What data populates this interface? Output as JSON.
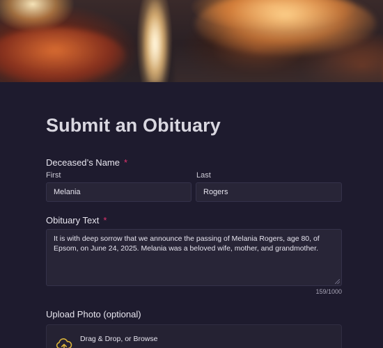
{
  "form": {
    "title": "Submit an Obituary",
    "required_marker": "*",
    "name": {
      "label": "Deceased’s Name",
      "first_label": "First",
      "first_value": "Melania",
      "last_label": "Last",
      "last_value": "Rogers"
    },
    "obituary": {
      "label": "Obituary Text",
      "value": "It is with deep sorrow that we announce the passing of Melania Rogers, age 80, of Epsom, on June 24, 2025. Melania was a beloved wife, mother, and grandmother.",
      "counter": "159/1000"
    },
    "upload": {
      "label": "Upload Photo (optional)",
      "title": "Drag & Drop, or Browse",
      "hint": "",
      "icon": "cloud-upload-icon",
      "accent_color": "#d9b23a"
    }
  },
  "colors": {
    "background": "#1e1b2e",
    "field": "#282537",
    "required": "#e2336e"
  }
}
